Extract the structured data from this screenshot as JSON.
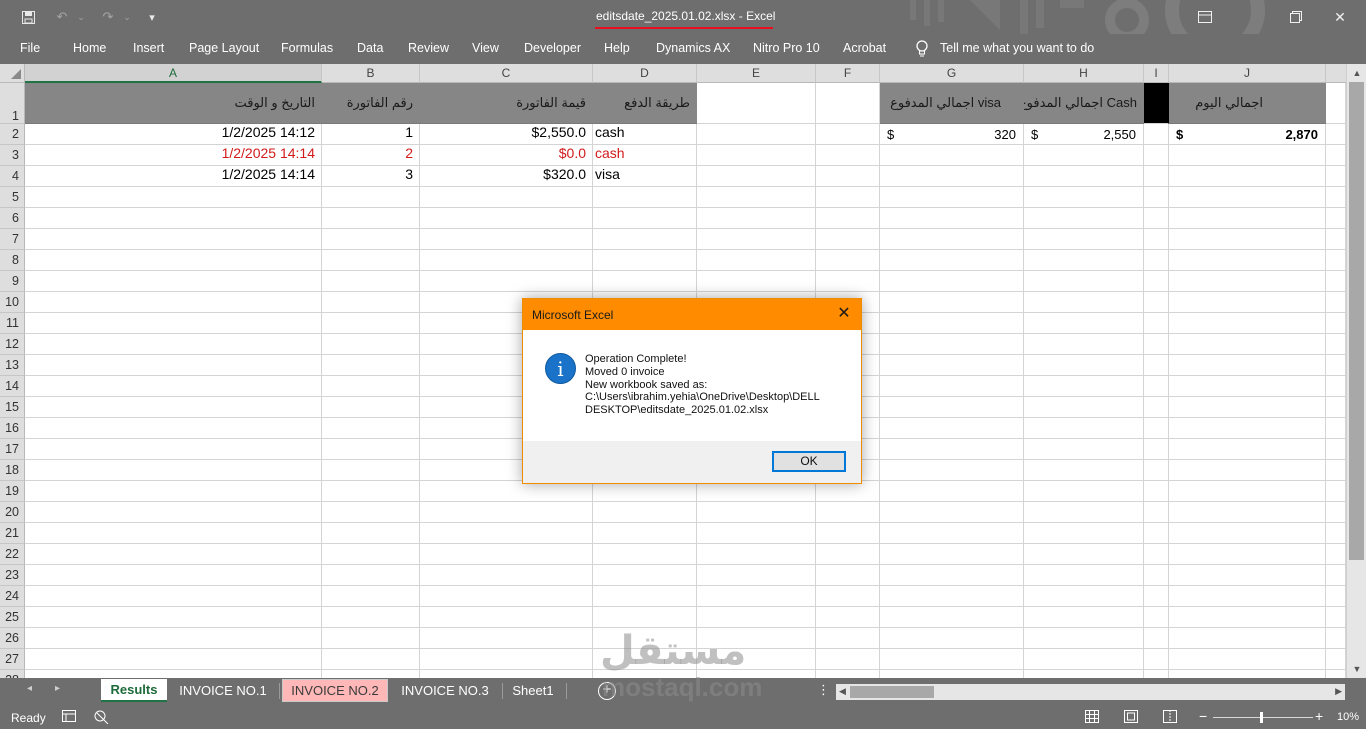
{
  "window": {
    "title": "editsdate_2025.01.02.xlsx  -  Excel"
  },
  "ribbon": {
    "tabs": [
      "File",
      "Home",
      "Insert",
      "Page Layout",
      "Formulas",
      "Data",
      "Review",
      "View",
      "Developer",
      "Help",
      "Dynamics AX",
      "Nitro Pro 10",
      "Acrobat"
    ],
    "tell_me": "Tell me what you want to do"
  },
  "columns": [
    "A",
    "B",
    "C",
    "D",
    "E",
    "F",
    "G",
    "H",
    "I",
    "J"
  ],
  "rows": [
    "1",
    "2",
    "3",
    "4",
    "5",
    "6",
    "7",
    "8",
    "9",
    "10",
    "11",
    "12",
    "13",
    "14",
    "15",
    "16",
    "17",
    "18",
    "19",
    "20",
    "21",
    "22",
    "23",
    "24",
    "25",
    "26",
    "27",
    "28"
  ],
  "sheet": {
    "headers": {
      "A": "التاريخ و الوقت",
      "B": "رقم الفاتورة",
      "C": "قيمة الفاتورة",
      "D": "طريقة الدفع",
      "G": "اجمالي المدفوع visa",
      "H": "اجمالي المدفوع Cash",
      "J": "اجمالي اليوم"
    },
    "data_rows": [
      {
        "date": "1/2/2025 14:12",
        "invoice": "1",
        "amount": "$2,550.0",
        "method": "cash"
      },
      {
        "date": "1/2/2025 14:14",
        "invoice": "2",
        "amount": "$0.0",
        "method": "cash"
      },
      {
        "date": "1/2/2025 14:14",
        "invoice": "3",
        "amount": "$320.0",
        "method": "visa"
      }
    ],
    "totals": {
      "currency": "$",
      "visa": "320",
      "cash": "2,550",
      "day": "2,870"
    }
  },
  "sheet_tabs": [
    "Results",
    "INVOICE NO.1",
    "INVOICE NO.2",
    "INVOICE NO.3",
    "Sheet1"
  ],
  "status": {
    "ready": "Ready",
    "zoom": "10%"
  },
  "dialog": {
    "title": "Microsoft Excel",
    "lines": [
      "Operation Complete!",
      "Moved 0 invoice",
      "New workbook saved as:",
      "C:\\Users\\ibrahim.yehia\\OneDrive\\Desktop\\DELL",
      "DESKTOP\\editsdate_2025.01.02.xlsx"
    ],
    "ok_label": "OK",
    "icon": "info-icon"
  },
  "watermark": {
    "arabic": "مستقل",
    "latin": "mostaql.com"
  },
  "colors": {
    "title_bar": "#6e6e6e",
    "dialog_title": "#ff8c00",
    "header_fill": "#868686",
    "error_text": "#d11b1b",
    "selected_tab_pink": "#ffb7b7",
    "excel_green": "#217346"
  }
}
